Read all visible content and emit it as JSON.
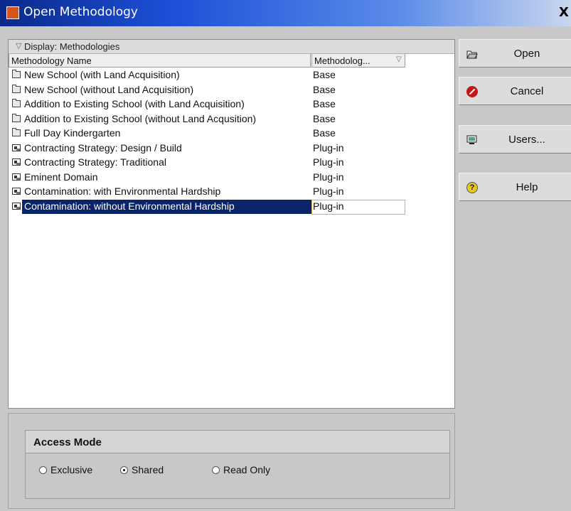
{
  "window": {
    "title": "Open Methodology",
    "close_glyph": "X"
  },
  "list": {
    "display_label": "Display: Methodologies",
    "columns": [
      "Methodology Name",
      "Methodolog..."
    ],
    "rows": [
      {
        "name": "New School (with Land Acquisition)",
        "type": "Base",
        "icon": "folder-icon"
      },
      {
        "name": "New School (without Land Acquisition)",
        "type": "Base",
        "icon": "folder-icon"
      },
      {
        "name": "Addition to Existing School (with Land Acquisition)",
        "type": "Base",
        "icon": "folder-icon"
      },
      {
        "name": "Addition to Existing School (without Land Acqusition)",
        "type": "Base",
        "icon": "folder-icon"
      },
      {
        "name": "Full Day Kindergarten",
        "type": "Base",
        "icon": "folder-icon"
      },
      {
        "name": "Contracting Strategy: Design / Build",
        "type": "Plug-in",
        "icon": "plugin-icon"
      },
      {
        "name": "Contracting Strategy: Traditional",
        "type": "Plug-in",
        "icon": "plugin-icon"
      },
      {
        "name": "Eminent Domain",
        "type": "Plug-in",
        "icon": "plugin-icon"
      },
      {
        "name": "Contamination: with Environmental Hardship",
        "type": "Plug-in",
        "icon": "plugin-icon"
      },
      {
        "name": "Contamination: without Environmental Hardship",
        "type": "Plug-in",
        "icon": "plugin-icon",
        "selected": true
      }
    ]
  },
  "access_mode": {
    "title": "Access Mode",
    "options": [
      "Exclusive",
      "Shared",
      "Read Only"
    ],
    "selected": "Shared"
  },
  "buttons": {
    "open": "Open",
    "cancel": "Cancel",
    "users": "Users...",
    "help": "Help"
  },
  "colors": {
    "title_gradient_start": "#0a2a8a",
    "selection": "#0a246a",
    "background": "#c8c8c8"
  }
}
